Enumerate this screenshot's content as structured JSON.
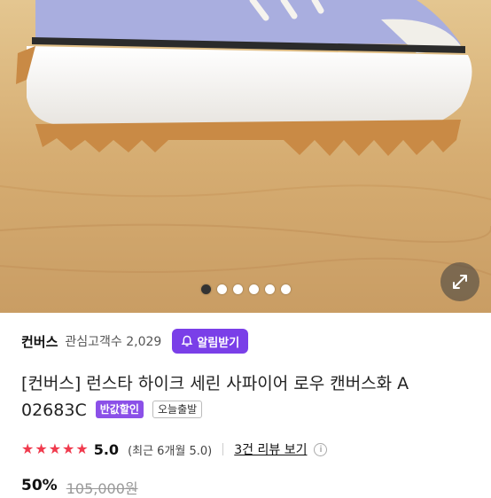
{
  "gallery": {
    "dots": [
      true,
      false,
      false,
      false,
      false,
      false
    ],
    "expand_icon": "expand-arrows-icon"
  },
  "brand": {
    "name": "컨버스",
    "favorites_label": "관심고객수 2,029",
    "alarm_label": "알림받기",
    "alarm_icon": "bell-plus-icon",
    "accent_color": "#7a3fe8"
  },
  "product": {
    "title": "[컨버스] 런스타 하이크 세린 사파이어 로우 캔버스화 A 02683C",
    "badge_half_price": "반값할인",
    "badge_today_ship": "오늘출발"
  },
  "rating": {
    "stars": 5,
    "score": "5.0",
    "recent": "(최근 6개월 5.0)",
    "reviews_link": "3건 리뷰 보기",
    "info_symbol": "i",
    "star_color": "#f03a4d"
  },
  "price": {
    "discount": "50%",
    "original": "105,000원"
  }
}
